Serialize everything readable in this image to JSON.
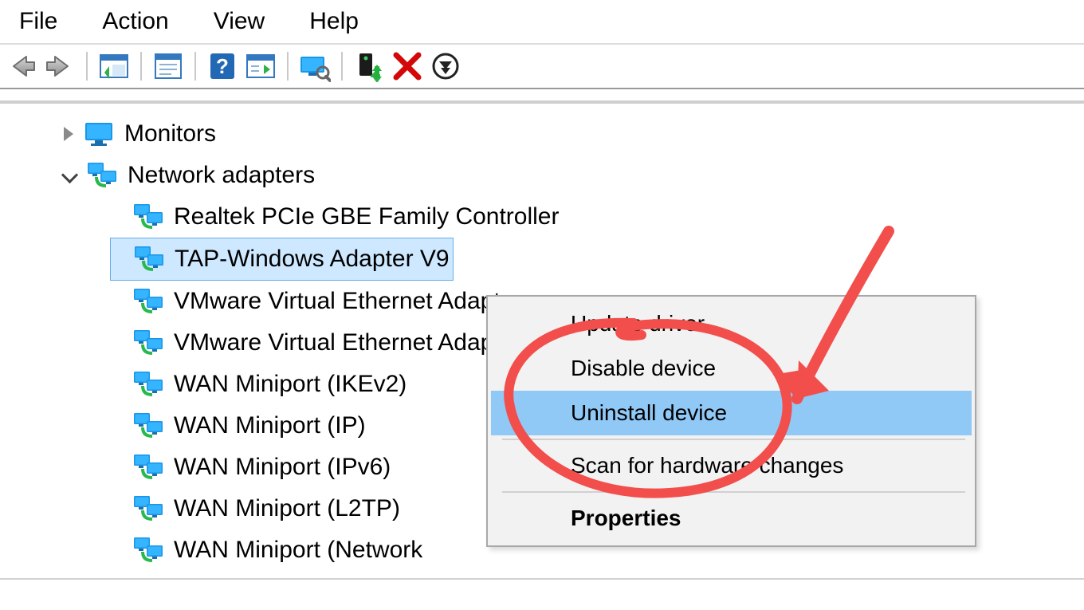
{
  "menu": {
    "file": "File",
    "action": "Action",
    "view": "View",
    "help": "Help"
  },
  "toolbar_icons": {
    "back": "back-arrow",
    "forward": "forward-arrow",
    "show_hide_tree": "show-hide-tree",
    "properties_sheet": "properties-sheet",
    "help": "help",
    "action_list": "action-list",
    "scan": "scan-monitor",
    "enable": "enable-device",
    "delete": "delete-x",
    "update": "update-driver"
  },
  "tree": {
    "monitors": {
      "label": "Monitors",
      "expanded": false
    },
    "network_adapters": {
      "label": "Network adapters",
      "expanded": true,
      "children": [
        {
          "label": "Realtek PCIe GBE Family Controller",
          "selected": false
        },
        {
          "label": "TAP-Windows Adapter V9",
          "selected": true
        },
        {
          "label": "VMware Virtual Ethernet Adapter",
          "selected": false
        },
        {
          "label": "VMware Virtual Ethernet Adapter",
          "selected": false
        },
        {
          "label": "WAN Miniport (IKEv2)",
          "selected": false
        },
        {
          "label": "WAN Miniport (IP)",
          "selected": false
        },
        {
          "label": "WAN Miniport (IPv6)",
          "selected": false
        },
        {
          "label": "WAN Miniport (L2TP)",
          "selected": false
        },
        {
          "label": "WAN Miniport (Network",
          "selected": false
        }
      ]
    }
  },
  "context_menu": {
    "items": [
      {
        "label": "Update driver",
        "highlighted": false
      },
      {
        "label": "Disable device",
        "highlighted": false
      },
      {
        "label": "Uninstall device",
        "highlighted": true
      },
      {
        "label": "Scan for hardware changes",
        "highlighted": false
      },
      {
        "label": "Properties",
        "highlighted": false,
        "bold": true
      }
    ]
  },
  "annotation": {
    "type": "arrow-and-circle",
    "color": "#f24e4c",
    "target": "Uninstall device"
  }
}
